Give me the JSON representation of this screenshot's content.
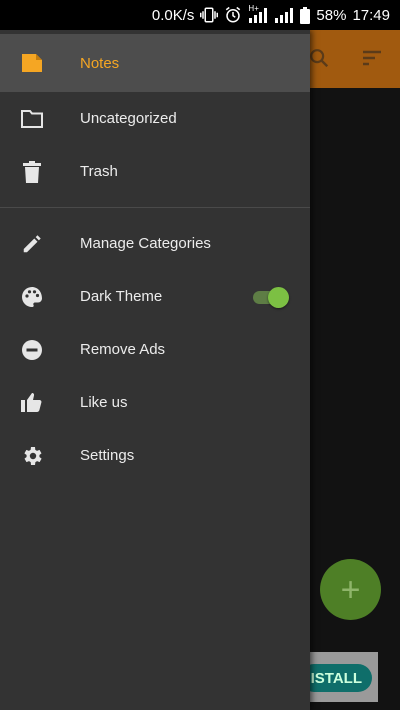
{
  "status_bar": {
    "net_speed": "0.0K/s",
    "network_type": "H+",
    "battery": "58%",
    "time": "17:49"
  },
  "drawer": {
    "items": [
      {
        "label": "Notes",
        "icon": "note-icon",
        "selected": true
      },
      {
        "label": "Uncategorized",
        "icon": "folder-icon"
      },
      {
        "label": "Trash",
        "icon": "trash-icon"
      },
      {
        "label": "Manage Categories",
        "icon": "pencil-icon"
      },
      {
        "label": "Dark Theme",
        "icon": "palette-icon",
        "toggle_on": true
      },
      {
        "label": "Remove Ads",
        "icon": "minus-circle-icon"
      },
      {
        "label": "Like us",
        "icon": "thumbs-up-icon"
      },
      {
        "label": "Settings",
        "icon": "gear-icon"
      }
    ]
  },
  "fab": {
    "symbol": "+"
  },
  "ad": {
    "button_label": "ISTALL"
  },
  "colors": {
    "accent": "#f5a623",
    "drawer_bg": "#333333",
    "selected_bg": "#4d4d4d",
    "toggle_on": "#7cc043",
    "appbar": "#a15a0f"
  }
}
